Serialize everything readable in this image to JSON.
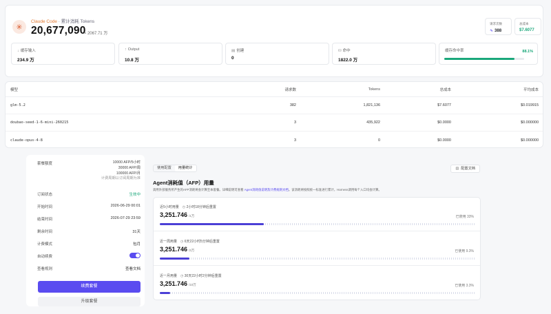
{
  "header": {
    "brand": "Claude Code",
    "subtitle": "累计消耗 Tokens",
    "total_tokens": "20,677,090",
    "total_tokens_sub": "≈ 2067.71 万",
    "mini": [
      {
        "label": "请求次数",
        "value": "388",
        "icon": "activity-icon"
      },
      {
        "label": "总成本",
        "value": "$7.6077",
        "color": "#1aa77a"
      }
    ],
    "stats": [
      {
        "label": "缓存输入",
        "value": "234.9 万",
        "icon": "download-arrow-icon"
      },
      {
        "label": "Output",
        "value": "10.8 万",
        "icon": "upload-arrow-icon"
      },
      {
        "label": "创建",
        "value": "0",
        "icon": "document-icon"
      },
      {
        "label": "命中",
        "value": "1822.0 万",
        "icon": "database-icon"
      }
    ],
    "cache_hit": {
      "label": "缓存命中率",
      "percent_text": "88.1%",
      "fraction": 0.881
    }
  },
  "table": {
    "columns": [
      "模型",
      "请求数",
      "Tokens",
      "总成本",
      "平均成本"
    ],
    "rows": [
      [
        "glm-5.2",
        "382",
        "1,821,136",
        "$7.6077",
        "$0.019915"
      ],
      [
        "doubao-seed-1-6-mini-260215",
        "3",
        "435,922",
        "$0.0000",
        "$0.000000"
      ],
      [
        "claude-opus-4-8",
        "3",
        "0",
        "$0.0000",
        "$0.000000"
      ]
    ]
  },
  "subscription": {
    "quota_label": "套餐额度",
    "quota_lines": [
      "10000 AFP/5小时",
      "30000 AFP/周",
      "100000 AFP/月",
      "计费周期以订阅周期为准"
    ],
    "rows": [
      {
        "k": "订阅状态",
        "v": "生效中"
      },
      {
        "k": "开始时间",
        "v": "2026-06-29 00:01"
      },
      {
        "k": "结束时间",
        "v": "2026-07-29 23:59"
      },
      {
        "k": "剩余时间",
        "v": "31天"
      },
      {
        "k": "计费模式",
        "v": "包月"
      },
      {
        "k": "自动续费",
        "v": ""
      },
      {
        "k": "查看规则",
        "v": "查看文档"
      }
    ],
    "renew_button": "续费套餐",
    "change_button": "升级套餐"
  },
  "afp": {
    "tabs": [
      "使用配置",
      "用量统计"
    ],
    "doc_button": "配置文档",
    "title": "Agent消耗值（AFP）用量",
    "desc_pre": "调用外部服务所产生的AFP消耗将会计算至本套餐。详细说明可查看 ",
    "desc_link": "Agent消耗值说明及计费规则文档",
    "desc_post": "。该消耗将按照统一标准进行累计，Harness调用每个入口均会计算。",
    "sections": [
      {
        "name": "近5小时用量",
        "reset": "2小时18分钟后重置",
        "value": "3,251.746",
        "unit": "/1万",
        "right": "已使用 33%",
        "fraction": 0.33
      },
      {
        "name": "近一周用量",
        "reset": "6天22小时5分钟后重置",
        "value": "3,251.746",
        "unit": "/3万",
        "right": "已使用 9.3%",
        "fraction": 0.093
      },
      {
        "name": "近一月用量",
        "reset": "30天22小时2分钟后重置",
        "value": "3,251.746",
        "unit": "/10万",
        "right": "已使用 3.3%",
        "fraction": 0.033
      }
    ]
  }
}
